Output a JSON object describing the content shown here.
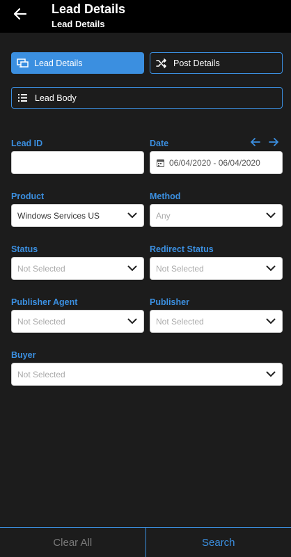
{
  "header": {
    "title": "Lead Details",
    "subtitle": "Lead Details"
  },
  "tabs": {
    "lead_details": "Lead Details",
    "post_details": "Post Details",
    "lead_body": "Lead Body"
  },
  "form": {
    "lead_id": {
      "label": "Lead ID",
      "value": ""
    },
    "date": {
      "label": "Date",
      "value": "06/04/2020 - 06/04/2020"
    },
    "product": {
      "label": "Product",
      "value": "Windows Services US"
    },
    "method": {
      "label": "Method",
      "value": "Any"
    },
    "status": {
      "label": "Status",
      "value": "Not Selected"
    },
    "redirect_status": {
      "label": "Redirect Status",
      "value": "Not Selected"
    },
    "publisher_agent": {
      "label": "Publisher Agent",
      "value": "Not Selected"
    },
    "publisher": {
      "label": "Publisher",
      "value": "Not Selected"
    },
    "buyer": {
      "label": "Buyer",
      "value": "Not Selected"
    }
  },
  "footer": {
    "clear_all": "Clear All",
    "search": "Search"
  },
  "colors": {
    "accent": "#3b8fe0",
    "background": "#1c1c1c",
    "topbar": "#000000"
  },
  "icons": {
    "back": "arrow-left-icon",
    "lead_details_tab": "monitor-network-icon",
    "post_details_tab": "shuffle-icon",
    "lead_body_tab": "list-icon",
    "date": "calendar-icon",
    "date_prev": "arrow-left-icon",
    "date_next": "arrow-right-icon",
    "dropdown": "chevron-down-icon"
  }
}
